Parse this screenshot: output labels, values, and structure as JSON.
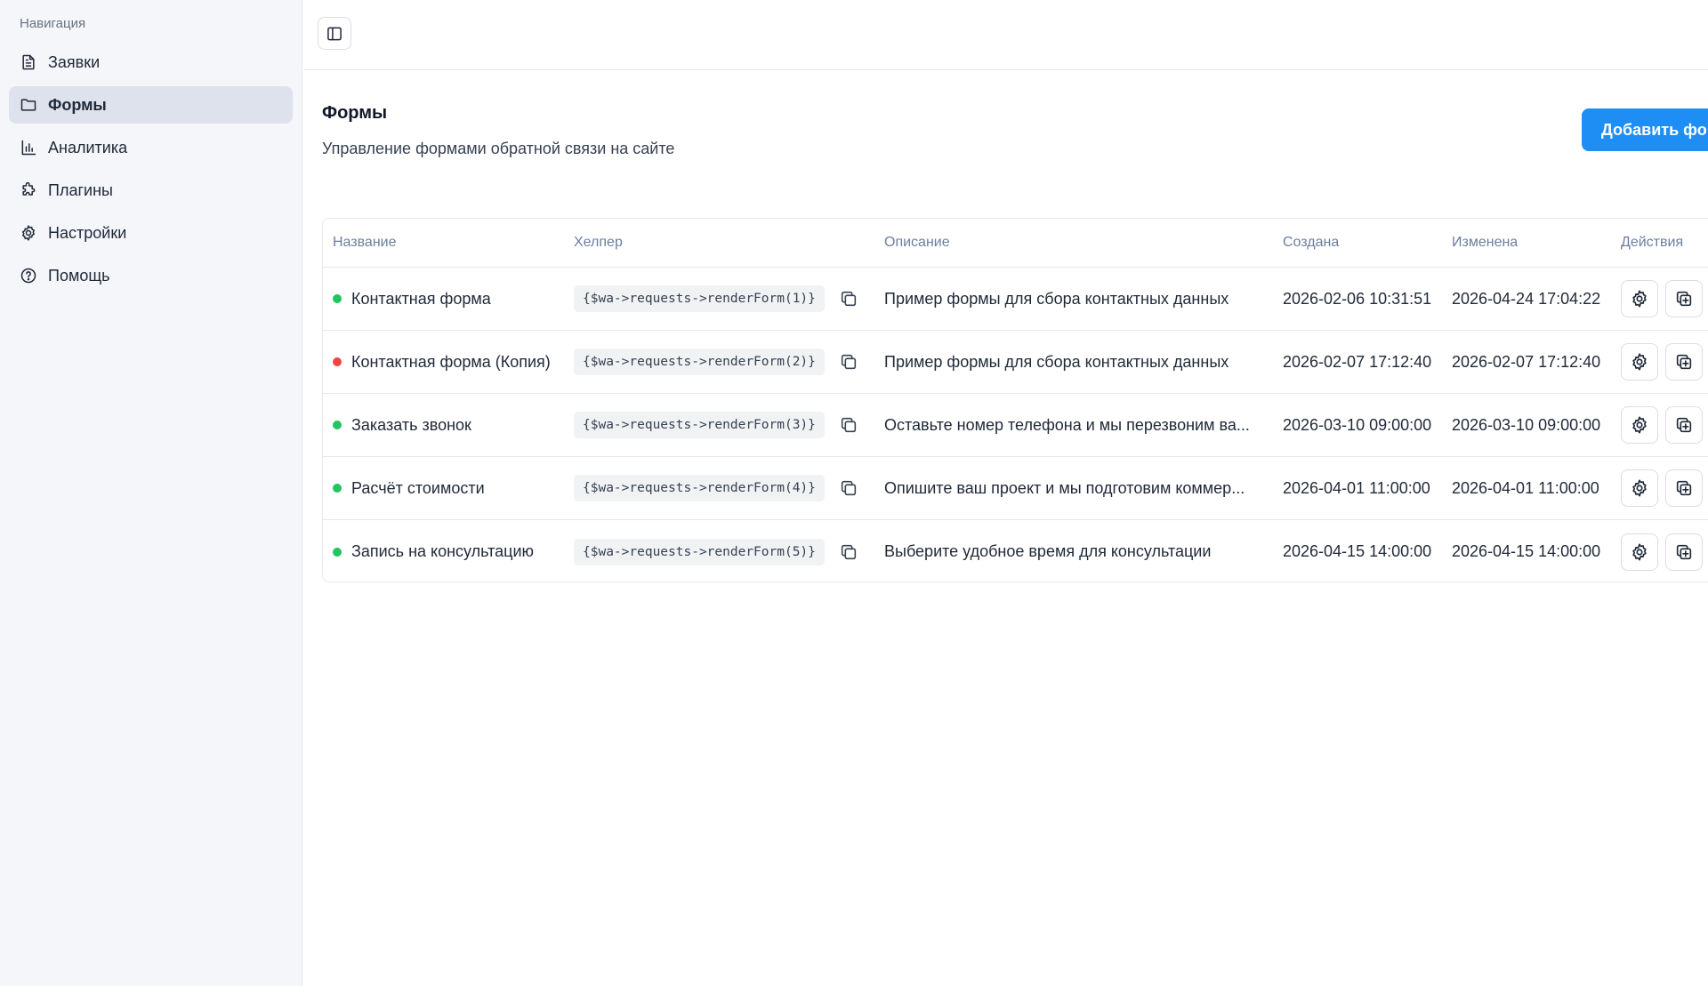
{
  "sidebar": {
    "caption": "Навигация",
    "items": [
      {
        "label": "Заявки",
        "icon": "document-icon"
      },
      {
        "label": "Формы",
        "icon": "folder-icon",
        "active": true
      },
      {
        "label": "Аналитика",
        "icon": "bar-chart-icon"
      },
      {
        "label": "Плагины",
        "icon": "puzzle-icon"
      },
      {
        "label": "Настройки",
        "icon": "gear-icon"
      },
      {
        "label": "Помощь",
        "icon": "help-circle-icon"
      }
    ]
  },
  "header": {
    "toggle_icon": "sidebar-toggle-icon"
  },
  "page": {
    "title": "Формы",
    "subtitle": "Управление формами обратной связи на сайте",
    "add_button": "Добавить форму"
  },
  "colors": {
    "accent": "#1e8ef5",
    "status_active": "#22c55e",
    "status_inactive": "#ef4444"
  },
  "table": {
    "columns": {
      "name": "Название",
      "helper": "Хелпер",
      "description": "Описание",
      "created": "Создана",
      "updated": "Изменена",
      "actions": "Действия"
    },
    "rows": [
      {
        "status": "active",
        "name": "Контактная форма",
        "helper": "{$wa->requests->renderForm(1)}",
        "description": "Пример формы для сбора контактных данных",
        "created": "2026-02-06 10:31:51",
        "updated": "2026-04-24 17:04:22"
      },
      {
        "status": "inactive",
        "name": "Контактная форма (Копия)",
        "helper": "{$wa->requests->renderForm(2)}",
        "description": "Пример формы для сбора контактных данных",
        "created": "2026-02-07 17:12:40",
        "updated": "2026-02-07 17:12:40"
      },
      {
        "status": "active",
        "name": "Заказать звонок",
        "helper": "{$wa->requests->renderForm(3)}",
        "description": "Оставьте номер телефона и мы перезвоним ва...",
        "created": "2026-03-10 09:00:00",
        "updated": "2026-03-10 09:00:00"
      },
      {
        "status": "active",
        "name": "Расчёт стоимости",
        "helper": "{$wa->requests->renderForm(4)}",
        "description": "Опишите ваш проект и мы подготовим коммер...",
        "created": "2026-04-01 11:00:00",
        "updated": "2026-04-01 11:00:00"
      },
      {
        "status": "active",
        "name": "Запись на консультацию",
        "helper": "{$wa->requests->renderForm(5)}",
        "description": "Выберите удобное время для консультации",
        "created": "2026-04-15 14:00:00",
        "updated": "2026-04-15 14:00:00"
      }
    ]
  }
}
